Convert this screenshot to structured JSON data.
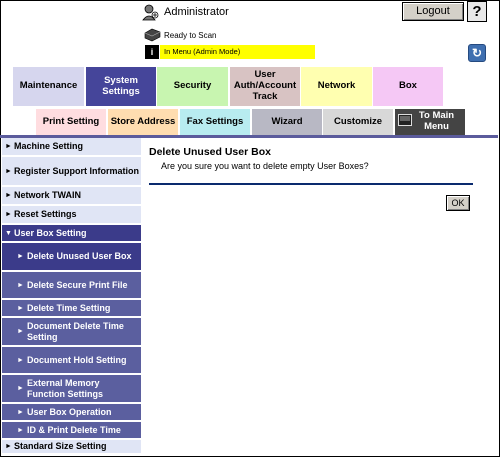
{
  "header": {
    "user_label": "Administrator",
    "logout_label": "Logout",
    "help_label": "?",
    "status_text": "Ready to Scan",
    "mode_text": "In Menu (Admin Mode)"
  },
  "tabs_row1": [
    {
      "label": "Maintenance"
    },
    {
      "label": "System Settings"
    },
    {
      "label": "Security"
    },
    {
      "label": "User Auth/Account Track"
    },
    {
      "label": "Network"
    },
    {
      "label": "Box"
    }
  ],
  "tabs_row2": [
    {
      "label": "Print Setting"
    },
    {
      "label": "Store Address"
    },
    {
      "label": "Fax Settings"
    },
    {
      "label": "Wizard"
    },
    {
      "label": "Customize"
    },
    {
      "label": "To Main Menu"
    }
  ],
  "sidebar": {
    "items": [
      {
        "label": "Machine Setting"
      },
      {
        "label": "Register Support Information"
      },
      {
        "label": "Network TWAIN"
      },
      {
        "label": "Reset Settings"
      },
      {
        "label": "User Box Setting"
      },
      {
        "label": "Delete Unused User Box"
      },
      {
        "label": "Delete Secure Print File"
      },
      {
        "label": "Delete Time Setting"
      },
      {
        "label": "Document Delete Time Setting"
      },
      {
        "label": "Document Hold Setting"
      },
      {
        "label": "External Memory Function Settings"
      },
      {
        "label": "User Box Operation"
      },
      {
        "label": "ID & Print Delete Time"
      },
      {
        "label": "Standard Size Setting"
      }
    ]
  },
  "content": {
    "title": "Delete Unused User Box",
    "message": "Are you sure you want to delete empty User Boxes?",
    "ok_label": "OK"
  },
  "colors": {
    "sidebar_active": "#3b3b8a",
    "sidebar_sub": "#5b5f9f",
    "sidebar_bg": "#e0e5f5",
    "mode_bar": "#ffff00"
  }
}
